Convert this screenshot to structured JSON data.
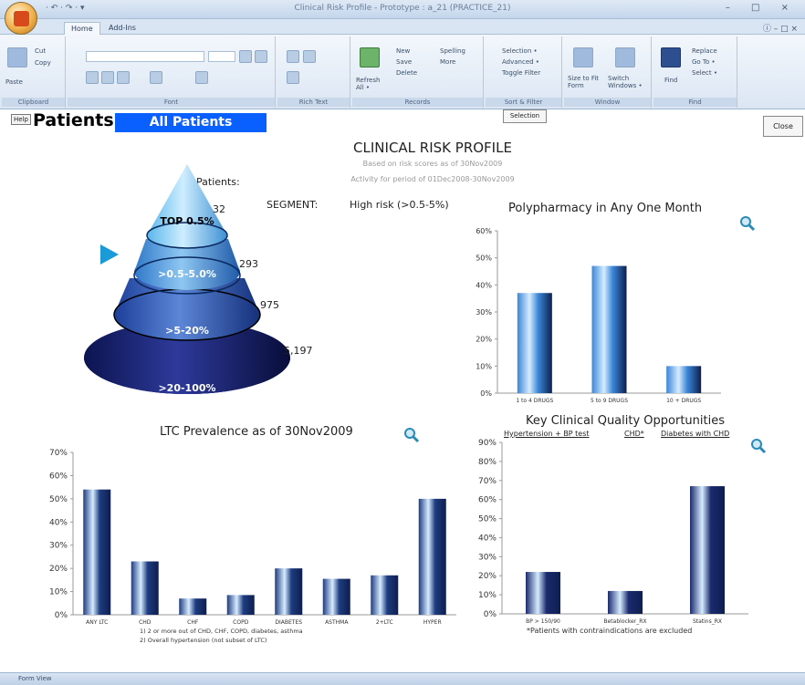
{
  "window": {
    "title": "Clinical Risk Profile - Prototype : a_21 (PRACTICE_21)",
    "qat": "· ↶ · ↷ · ▾",
    "controls": "– □ ×"
  },
  "tabs": [
    {
      "label": "Home"
    },
    {
      "label": "Add-Ins"
    }
  ],
  "ribbon": {
    "groups": [
      "Clipboard",
      "Font",
      "Rich Text",
      "Records",
      "Sort & Filter",
      "Window",
      "Find"
    ],
    "buttons": {
      "paste": "Paste",
      "cut": "Cut",
      "copy": "Copy",
      "refresh": "Refresh All •",
      "new": "New",
      "save": "Save",
      "delete": "Delete",
      "spelling": "Spelling",
      "more": "More",
      "selection": "Selection •",
      "advanced": "Advanced •",
      "toggle_filter": "Toggle Filter",
      "size_to_fit": "Size to Fit Form",
      "switch_windows": "Switch Windows •",
      "find": "Find",
      "replace": "Replace",
      "goto": "Go To •",
      "select": "Select •"
    }
  },
  "form": {
    "help": "Help",
    "patients_label": "Patients:",
    "patient_filter": "All Patients",
    "selection_btn": "Selection",
    "close_btn": "Close",
    "title": "CLINICAL RISK PROFILE",
    "subtitle1": "Based on risk scores as of 30Nov2009",
    "subtitle2": "Activity for period of 01Dec2008-30Nov2009",
    "segment_label": "SEGMENT:",
    "segment_value": "High risk (>0.5-5%)"
  },
  "pyramid": {
    "heading": "Patients:",
    "tiers": [
      {
        "label": "TOP 0.5%",
        "count": "32"
      },
      {
        "label": ">0.5-5.0%",
        "count": "293"
      },
      {
        "label": ">5-20%",
        "count": "975"
      },
      {
        "label": ">20-100%",
        "count": "5,197"
      }
    ],
    "selected_index": 1
  },
  "status_bar": "Form View",
  "chart_data": [
    {
      "type": "bar",
      "title": "Polypharmacy in Any One Month",
      "categories": [
        "1 to 4 DRUGS",
        "5 to 9 DRUGS",
        "10 + DRUGS"
      ],
      "values": [
        37,
        47,
        10
      ],
      "ylim": [
        0,
        60
      ],
      "yticks": [
        "0%",
        "10%",
        "20%",
        "30%",
        "40%",
        "50%",
        "60%"
      ],
      "grid": false,
      "color": "#3a86d8"
    },
    {
      "type": "bar",
      "title": "LTC Prevalence as of 30Nov2009",
      "categories": [
        "ANY LTC",
        "CHD",
        "CHF",
        "COPD",
        "DIABETES",
        "ASTHMA",
        "2+LTC",
        "HYPER"
      ],
      "values": [
        54,
        23,
        7,
        8.5,
        20,
        15.5,
        17,
        50
      ],
      "ylim": [
        0,
        70
      ],
      "yticks": [
        "0%",
        "10%",
        "20%",
        "30%",
        "40%",
        "50%",
        "60%",
        "70%"
      ],
      "grid": false,
      "color": "#1e3c80",
      "footnotes": [
        "1) 2 or more out of CHD, CHF, COPD, diabetes, asthma",
        "2) Overall hypertension (not subset of LTC)"
      ]
    },
    {
      "type": "bar",
      "title": "Key Clinical Quality Opportunities",
      "links": [
        "Hypertension + BP test",
        "CHD*",
        "Diabetes with CHD"
      ],
      "categories": [
        "BP > 150/90",
        "Betablocker_RX",
        "Statins_RX"
      ],
      "values": [
        22,
        12,
        67
      ],
      "ylim": [
        0,
        90
      ],
      "yticks": [
        "0%",
        "10%",
        "20%",
        "30%",
        "40%",
        "50%",
        "60%",
        "70%",
        "80%",
        "90%"
      ],
      "grid": false,
      "color": "#1a2a6e",
      "note": "*Patients with contraindications are excluded"
    }
  ]
}
